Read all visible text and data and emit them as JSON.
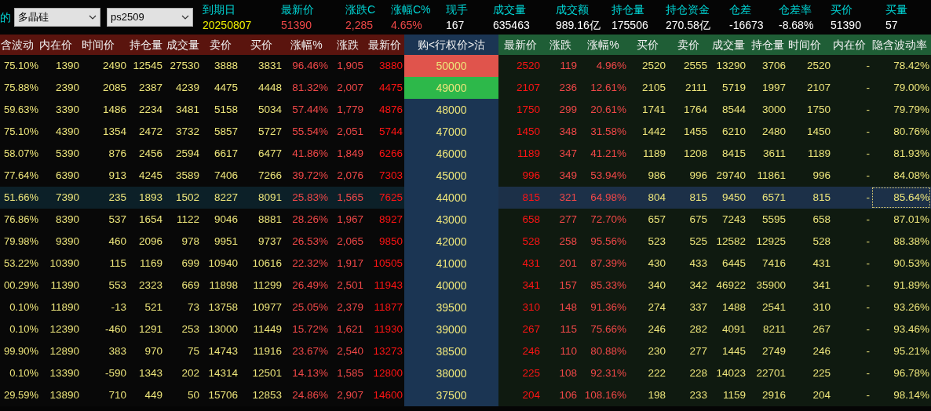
{
  "toolbar": {
    "label": "的",
    "selects": [
      {
        "value": "多晶硅"
      },
      {
        "value": "ps2509"
      }
    ]
  },
  "stats": [
    {
      "label": "到期日",
      "value": "20250807",
      "color": "#f0f000"
    },
    {
      "label": "最新价",
      "value": "51390",
      "color": "#f04848"
    },
    {
      "label": "涨跌C",
      "value": "2,285",
      "color": "#f04848"
    },
    {
      "label": "涨幅C%",
      "value": "4.65%",
      "color": "#f04848"
    },
    {
      "label": "现手",
      "value": "167",
      "color": "#ffffff"
    },
    {
      "label": "成交量",
      "value": "635463",
      "color": "#ffffff"
    },
    {
      "label": "成交额",
      "value": "989.16亿",
      "color": "#ffffff"
    },
    {
      "label": "持仓量",
      "value": "175506",
      "color": "#ffffff"
    },
    {
      "label": "持仓资金",
      "value": "270.58亿",
      "color": "#ffffff"
    },
    {
      "label": "仓差",
      "value": "-16673",
      "color": "#ffffff"
    },
    {
      "label": "仓差率",
      "value": "-8.68%",
      "color": "#ffffff"
    },
    {
      "label": "买价",
      "value": "51390",
      "color": "#ffffff"
    },
    {
      "label": "买量",
      "value": "57",
      "color": "#ffffff"
    }
  ],
  "table": {
    "call_columns": [
      "含波动",
      "内在价",
      "时间价",
      "持仓量",
      "成交量",
      "卖价",
      "买价",
      "涨幅%",
      "涨跌",
      "最新价"
    ],
    "strike_header": "购<行权价>沽",
    "put_columns": [
      "最新价",
      "涨跌",
      "涨幅%",
      "买价",
      "卖价",
      "成交量",
      "持仓量",
      "时间价",
      "内在价",
      "隐含波动率"
    ],
    "rows": [
      {
        "strike": "50000",
        "color": "#e0544c",
        "selected": false,
        "call": [
          "75.10%",
          "1390",
          "2490",
          "12545",
          "27530",
          "3888",
          "3831",
          "96.46%",
          "1,905",
          "3880"
        ],
        "put": [
          "2520",
          "119",
          "4.96%",
          "2520",
          "2555",
          "13290",
          "3706",
          "2520",
          "-",
          "78.42%"
        ]
      },
      {
        "strike": "49000",
        "color": "#2db84a",
        "selected": false,
        "call": [
          "75.88%",
          "2390",
          "2085",
          "2387",
          "4239",
          "4475",
          "4448",
          "81.32%",
          "2,007",
          "4475"
        ],
        "put": [
          "2107",
          "236",
          "12.61%",
          "2105",
          "2111",
          "5719",
          "1997",
          "2107",
          "-",
          "79.00%"
        ]
      },
      {
        "strike": "48000",
        "selected": false,
        "call": [
          "59.63%",
          "3390",
          "1486",
          "2234",
          "3481",
          "5158",
          "5034",
          "57.44%",
          "1,779",
          "4876"
        ],
        "put": [
          "1750",
          "299",
          "20.61%",
          "1741",
          "1764",
          "8544",
          "3000",
          "1750",
          "-",
          "79.79%"
        ]
      },
      {
        "strike": "47000",
        "selected": false,
        "call": [
          "75.10%",
          "4390",
          "1354",
          "2472",
          "3732",
          "5857",
          "5727",
          "55.54%",
          "2,051",
          "5744"
        ],
        "put": [
          "1450",
          "348",
          "31.58%",
          "1442",
          "1455",
          "6210",
          "2480",
          "1450",
          "-",
          "80.76%"
        ]
      },
      {
        "strike": "46000",
        "selected": false,
        "call": [
          "58.07%",
          "5390",
          "876",
          "2456",
          "2594",
          "6617",
          "6477",
          "41.86%",
          "1,849",
          "6266"
        ],
        "put": [
          "1189",
          "347",
          "41.21%",
          "1189",
          "1208",
          "8415",
          "3611",
          "1189",
          "-",
          "81.93%"
        ]
      },
      {
        "strike": "45000",
        "selected": false,
        "call": [
          "77.64%",
          "6390",
          "913",
          "4245",
          "3589",
          "7406",
          "7266",
          "39.72%",
          "2,076",
          "7303"
        ],
        "put": [
          "996",
          "349",
          "53.94%",
          "986",
          "996",
          "29740",
          "11861",
          "996",
          "-",
          "84.08%"
        ]
      },
      {
        "strike": "44000",
        "selected": true,
        "call": [
          "51.66%",
          "7390",
          "235",
          "1893",
          "1502",
          "8227",
          "8091",
          "25.83%",
          "1,565",
          "7625"
        ],
        "put": [
          "815",
          "321",
          "64.98%",
          "804",
          "815",
          "9450",
          "6571",
          "815",
          "-",
          "85.64%"
        ]
      },
      {
        "strike": "43000",
        "selected": false,
        "call": [
          "76.86%",
          "8390",
          "537",
          "1654",
          "1122",
          "9046",
          "8881",
          "28.26%",
          "1,967",
          "8927"
        ],
        "put": [
          "658",
          "277",
          "72.70%",
          "657",
          "675",
          "7243",
          "5595",
          "658",
          "-",
          "87.01%"
        ]
      },
      {
        "strike": "42000",
        "selected": false,
        "call": [
          "79.98%",
          "9390",
          "460",
          "2096",
          "978",
          "9951",
          "9737",
          "26.53%",
          "2,065",
          "9850"
        ],
        "put": [
          "528",
          "258",
          "95.56%",
          "523",
          "525",
          "12582",
          "12925",
          "528",
          "-",
          "88.38%"
        ]
      },
      {
        "strike": "41000",
        "selected": false,
        "call": [
          "53.22%",
          "10390",
          "115",
          "1169",
          "699",
          "10940",
          "10616",
          "22.32%",
          "1,917",
          "10505"
        ],
        "put": [
          "431",
          "201",
          "87.39%",
          "430",
          "433",
          "6445",
          "7416",
          "431",
          "-",
          "90.53%"
        ]
      },
      {
        "strike": "40000",
        "selected": false,
        "call": [
          "00.29%",
          "11390",
          "553",
          "2323",
          "669",
          "11898",
          "11299",
          "26.49%",
          "2,501",
          "11943"
        ],
        "put": [
          "341",
          "157",
          "85.33%",
          "340",
          "342",
          "46922",
          "35900",
          "341",
          "-",
          "91.89%"
        ]
      },
      {
        "strike": "39500",
        "selected": false,
        "call": [
          "0.10%",
          "11890",
          "-13",
          "521",
          "73",
          "13758",
          "10977",
          "25.05%",
          "2,379",
          "11877"
        ],
        "put": [
          "310",
          "148",
          "91.36%",
          "274",
          "337",
          "1488",
          "2541",
          "310",
          "-",
          "93.26%"
        ]
      },
      {
        "strike": "39000",
        "selected": false,
        "call": [
          "0.10%",
          "12390",
          "-460",
          "1291",
          "253",
          "13000",
          "11449",
          "15.72%",
          "1,621",
          "11930"
        ],
        "put": [
          "267",
          "115",
          "75.66%",
          "246",
          "282",
          "4091",
          "8211",
          "267",
          "-",
          "93.46%"
        ]
      },
      {
        "strike": "38500",
        "selected": false,
        "call": [
          "99.90%",
          "12890",
          "383",
          "970",
          "75",
          "14743",
          "11916",
          "23.67%",
          "2,540",
          "13273"
        ],
        "put": [
          "246",
          "110",
          "80.88%",
          "230",
          "277",
          "1445",
          "2749",
          "246",
          "-",
          "95.21%"
        ]
      },
      {
        "strike": "38000",
        "selected": false,
        "call": [
          "0.10%",
          "13390",
          "-590",
          "1343",
          "202",
          "14314",
          "12501",
          "14.13%",
          "1,585",
          "12800"
        ],
        "put": [
          "225",
          "108",
          "92.31%",
          "222",
          "228",
          "14023",
          "22701",
          "225",
          "-",
          "96.78%"
        ]
      },
      {
        "strike": "37500",
        "selected": false,
        "call": [
          "29.59%",
          "13890",
          "710",
          "449",
          "50",
          "15706",
          "12853",
          "24.86%",
          "2,907",
          "14600"
        ],
        "put": [
          "204",
          "106",
          "108.16%",
          "198",
          "233",
          "1159",
          "2916",
          "204",
          "-",
          "98.14%"
        ]
      }
    ]
  }
}
